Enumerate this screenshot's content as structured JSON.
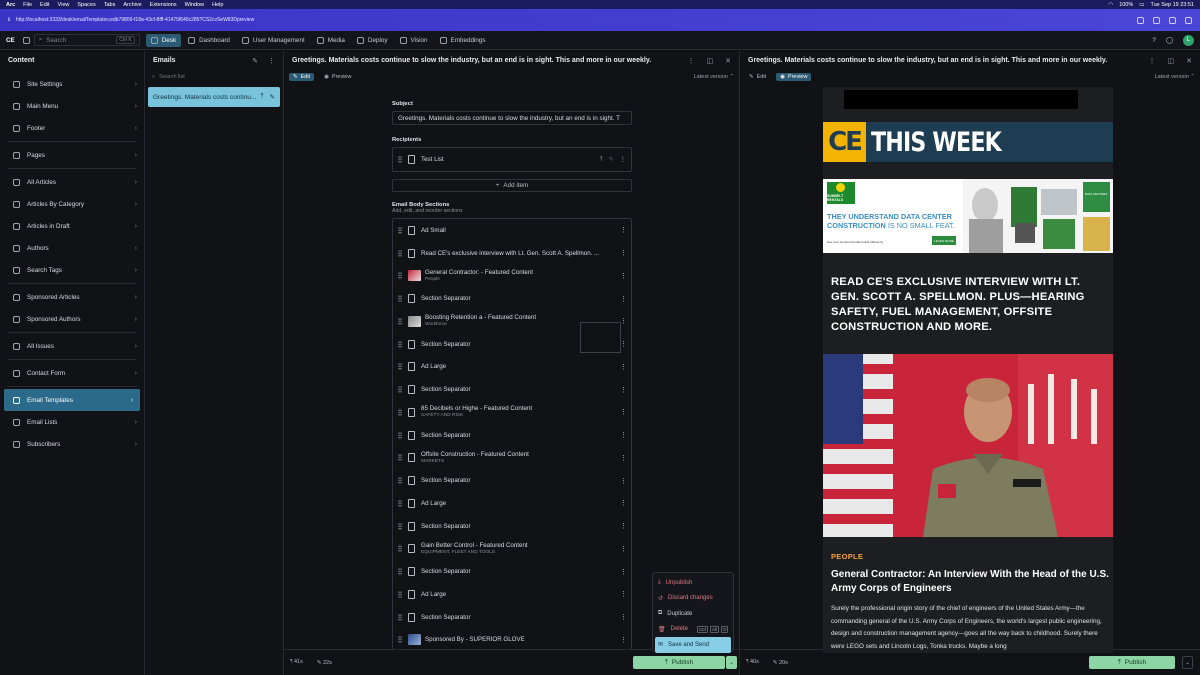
{
  "macbar": {
    "app": "Arc",
    "menus": [
      "File",
      "Edit",
      "View",
      "Spaces",
      "Tabs",
      "Archive",
      "Extensions",
      "Window",
      "Help"
    ],
    "battery": "100%",
    "datetime": "Tue Sep 19  23:51"
  },
  "browser": {
    "url": "http://localhost:3333/desk/emailTemplates;edb79809-f18a-43cf-8fff-41475f646c285?CS2cvSeW83Dpreview"
  },
  "topnav": {
    "logo": "CE",
    "search_placeholder": "Search",
    "search_shortcut": "Ctrl K",
    "items": [
      "Desk",
      "Dashboard",
      "User Management",
      "Media",
      "Deploy",
      "Vision",
      "Embeddings"
    ],
    "active": "Desk",
    "avatar": "L"
  },
  "content_pane": {
    "title": "Content",
    "groups": [
      [
        "Site Settings",
        "Main Menu",
        "Footer"
      ],
      [
        "Pages"
      ],
      [
        "All Articles",
        "Articles By Category",
        "Articles in Draft",
        "Authors",
        "Search Tags"
      ],
      [
        "Sponsored Articles",
        "Sponsored Authors"
      ],
      [
        "All Issues"
      ],
      [
        "Contact Form"
      ],
      [
        "Email Templates",
        "Email Lists",
        "Subscribers"
      ]
    ],
    "selected": "Email Templates"
  },
  "emails_pane": {
    "title": "Emails",
    "search_placeholder": "Search list",
    "item": "Greetings. Materials costs continu..."
  },
  "editor": {
    "title": "Greetings. Materials costs continue to slow the industry, but an end is in sight. This and more in our weekly.",
    "tabs": [
      "Edit",
      "Preview"
    ],
    "version": "Latest version",
    "subject_label": "Subject",
    "subject_value": "Greetings. Materials costs continue to slow the industry, but an end is in sight. T",
    "recipients_label": "Recipients",
    "recipient": "Test List",
    "add_item": "Add item",
    "sections_label": "Email Body Sections",
    "sections_sub": "Add, edit, and reorder sections",
    "sections": [
      {
        "title": "Ad Small",
        "sub": "",
        "thumb": "doc"
      },
      {
        "title": "Read CE's exclusive interview with Lt. Gen. Scott A. Spellmon. ...",
        "sub": "",
        "thumb": "doc"
      },
      {
        "title": "General Contractor: - Featured Content",
        "sub": "People",
        "thumb": "photo-red"
      },
      {
        "title": "Section Separator",
        "sub": "",
        "thumb": "doc"
      },
      {
        "title": "Boosting Retention a - Featured Content",
        "sub": "Workforce",
        "thumb": "photo-grey"
      },
      {
        "title": "Section Separator",
        "sub": "",
        "thumb": "doc"
      },
      {
        "title": "Ad Large",
        "sub": "",
        "thumb": "doc"
      },
      {
        "title": "Section Separator",
        "sub": "",
        "thumb": "doc"
      },
      {
        "title": "85 Decibels or Highe - Featured Content",
        "sub": "SAFETY AND RISK",
        "thumb": "doc"
      },
      {
        "title": "Section Separator",
        "sub": "",
        "thumb": "doc"
      },
      {
        "title": "Offsite Construction - Featured Content",
        "sub": "MARKETS",
        "thumb": "doc"
      },
      {
        "title": "Section Separator",
        "sub": "",
        "thumb": "doc"
      },
      {
        "title": "Ad Large",
        "sub": "",
        "thumb": "doc"
      },
      {
        "title": "Section Separator",
        "sub": "",
        "thumb": "doc"
      },
      {
        "title": "Gain Better Control - Featured Content",
        "sub": "EQUIPMENT, FLEET AND TOOLS",
        "thumb": "doc"
      },
      {
        "title": "Section Separator",
        "sub": "",
        "thumb": "doc"
      },
      {
        "title": "Ad Large",
        "sub": "",
        "thumb": "doc"
      },
      {
        "title": "Section Separator",
        "sub": "",
        "thumb": "doc"
      },
      {
        "title": "Sponsored By - SUPERIOR GLOVE",
        "sub": "",
        "thumb": "photo-blue"
      }
    ],
    "footer": {
      "published": "41s",
      "edited": "22s",
      "publish": "Publish"
    },
    "menu": [
      {
        "label": "Unpublish",
        "kind": "danger"
      },
      {
        "label": "Discard changes",
        "kind": "danger"
      },
      {
        "label": "Duplicate",
        "kind": "neutral"
      },
      {
        "label": "Delete",
        "kind": "danger",
        "keys": [
          "Ctrl",
          "Alt",
          "D"
        ]
      },
      {
        "label": "Save and Send",
        "kind": "highlight"
      }
    ]
  },
  "preview": {
    "title": "Greetings. Materials costs continue to slow the industry, but an end is in sight. This and more in our weekly.",
    "tabs": [
      "Edit",
      "Preview"
    ],
    "version": "Latest version",
    "logo_ce": "CE",
    "logo_text": "THIS WEEK",
    "ad": {
      "headline1": "THEY UNDERSTAND DATA CENTER",
      "headline2": "CONSTRUCTION",
      "headline3": "IS NO SMALL FEAT.",
      "sub": "See how Sunbelt Rentals builds differently.",
      "cta": "LEARN MORE",
      "brand": "SUNBELT RENTALS",
      "badge": "DATA CENTERS"
    },
    "headline": "Read CE's exclusive interview with Lt. Gen. Scott A. Spellmon. Plus—hearing safety, fuel management, offsite construction and more.",
    "category": "PEOPLE",
    "article_title": "General Contractor: An Interview With the Head of the U.S. Army Corps of Engineers",
    "body": "Surely the professional origin story of the chief of engineers of the United States Army—the commanding general of the U.S. Army Corps of Engineers, the world's largest public engineering, design and construction management agency—goes all the way back to childhood. Surely there were LEGO sets and Lincoln Logs, Tonka trucks. Maybe a long",
    "footer": {
      "published": "40s",
      "edited": "20s",
      "publish": "Publish"
    }
  },
  "colors": {
    "accent": "#2b6a8a",
    "publish": "#8ed5a6",
    "selected_email": "#7ac3dd",
    "ce_yellow": "#f2b400",
    "ce_blue": "#1e3d52",
    "category": "#f2a23a"
  }
}
